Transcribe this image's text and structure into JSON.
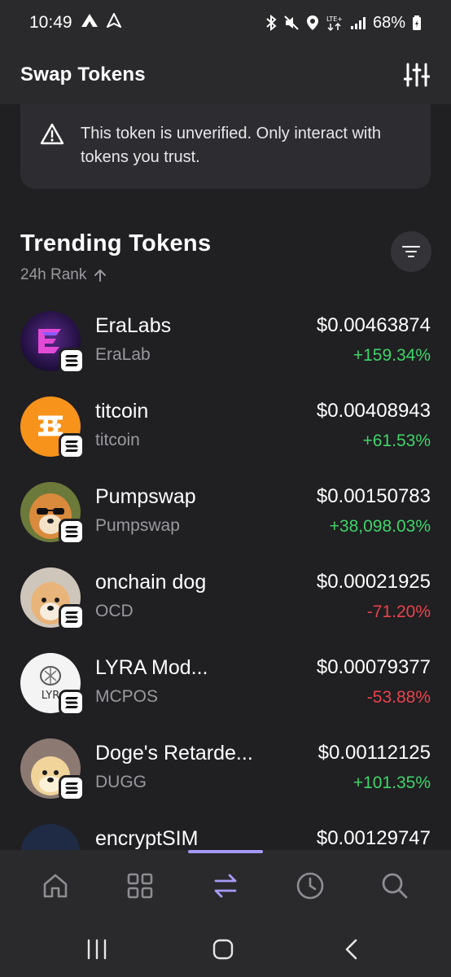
{
  "status_bar": {
    "time": "10:49",
    "battery": "68%"
  },
  "header": {
    "title": "Swap Tokens"
  },
  "warning": {
    "text": "This token is unverified. Only interact with tokens you trust."
  },
  "trending": {
    "title": "Trending Tokens",
    "rank_label": "24h Rank"
  },
  "tokens": [
    {
      "name": "EraLabs",
      "symbol": "EraLab",
      "price": "$0.00463874",
      "change": "+159.34%",
      "direction": "up"
    },
    {
      "name": "titcoin",
      "symbol": "titcoin",
      "price": "$0.00408943",
      "change": "+61.53%",
      "direction": "up"
    },
    {
      "name": "Pumpswap",
      "symbol": "Pumpswap",
      "price": "$0.00150783",
      "change": "+38,098.03%",
      "direction": "up"
    },
    {
      "name": "onchain dog",
      "symbol": "OCD",
      "price": "$0.00021925",
      "change": "-71.20%",
      "direction": "down"
    },
    {
      "name": "LYRA Mod...",
      "symbol": "MCPOS",
      "price": "$0.00079377",
      "change": "-53.88%",
      "direction": "down"
    },
    {
      "name": "Doge's Retarde...",
      "symbol": "DUGG",
      "price": "$0.00112125",
      "change": "+101.35%",
      "direction": "up"
    },
    {
      "name": "encryptSIM",
      "symbol": "",
      "price": "$0.00129747",
      "change": "",
      "direction": "up"
    }
  ],
  "bottom_nav": {
    "items": [
      "home-icon",
      "grid-icon",
      "swap-icon",
      "history-icon",
      "search-icon"
    ],
    "active": "swap-icon",
    "accent": "#a59af4"
  },
  "colors": {
    "positive": "#3fd46a",
    "negative": "#e8434b",
    "background": "#201f22"
  }
}
